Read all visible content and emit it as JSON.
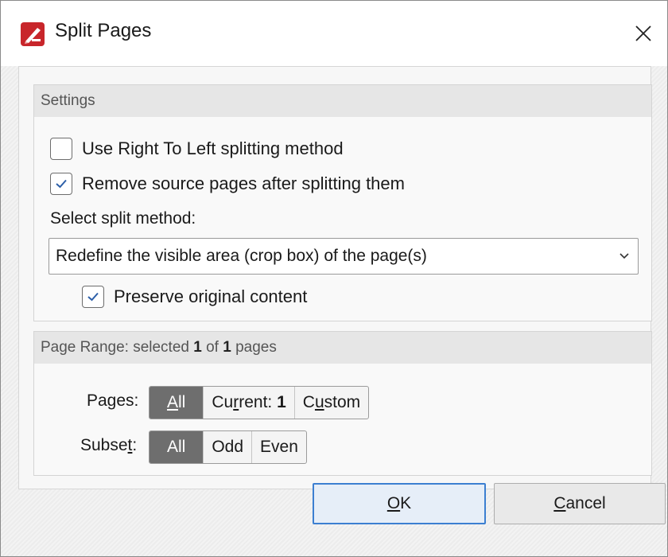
{
  "window": {
    "title": "Split Pages"
  },
  "settings": {
    "header": "Settings",
    "right_to_left": {
      "label": "Use Right To Left splitting method",
      "checked": false
    },
    "remove_source": {
      "label": "Remove source pages after splitting them",
      "checked": true
    },
    "method_label": "Select split method:",
    "method_value": "Redefine the visible area (crop box) of the page(s)",
    "preserve": {
      "label": "Preserve original content",
      "checked": true
    }
  },
  "page_range": {
    "header_prefix": "Page Range: selected ",
    "selected": "1",
    "of": " of ",
    "total": "1",
    "suffix": " pages",
    "pages_label_pre": "Pages",
    "pages_label_post": ":",
    "pages_options": [
      {
        "pre": "",
        "key": "A",
        "post": "ll"
      },
      {
        "pre": "Cu",
        "key": "r",
        "post": "rent: ",
        "num": "1"
      },
      {
        "pre": "C",
        "key": "u",
        "post": "stom"
      }
    ],
    "subset_label_pre": "Subse",
    "subset_label_key": "t",
    "subset_label_post": ":",
    "subset_options": [
      "All",
      "Odd",
      "Even"
    ]
  },
  "buttons": {
    "ok_key": "O",
    "ok_rest": "K",
    "cancel_key": "C",
    "cancel_rest": "ancel"
  },
  "colors": {
    "accent": "#3c7fd1",
    "icon_red": "#c8262b",
    "active_segment": "#6e6e6e"
  }
}
